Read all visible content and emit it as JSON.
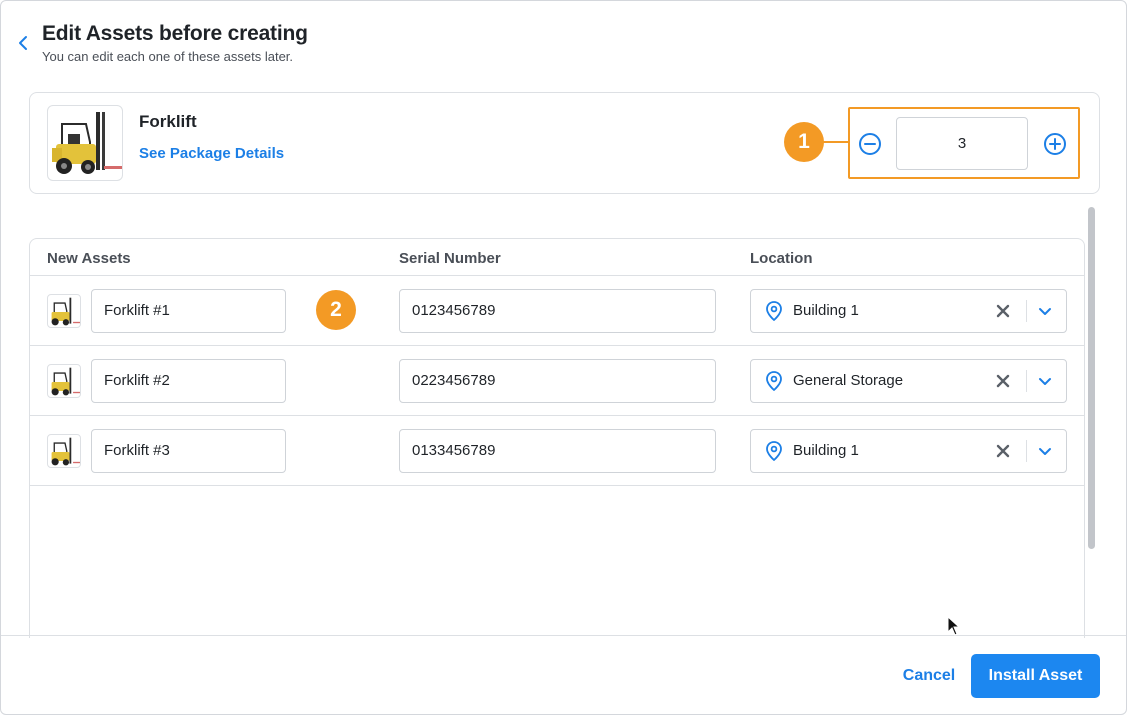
{
  "header": {
    "title": "Edit Assets before creating",
    "subtitle": "You can edit each one of these assets later."
  },
  "product": {
    "name": "Forklift",
    "link_label": "See Package Details",
    "quantity": "3"
  },
  "callouts": [
    "1",
    "2"
  ],
  "table": {
    "columns": [
      "New Assets",
      "Serial Number",
      "Location"
    ],
    "rows": [
      {
        "name": "Forklift #1",
        "serial": "0123456789",
        "location": "Building 1"
      },
      {
        "name": "Forklift #2",
        "serial": "0223456789",
        "location": "General Storage"
      },
      {
        "name": "Forklift #3",
        "serial": "0133456789",
        "location": "Building 1"
      }
    ]
  },
  "footer": {
    "cancel_label": "Cancel",
    "install_label": "Install Asset"
  },
  "colors": {
    "accent": "#1c87f0",
    "link": "#1c7fe6",
    "callout": "#f39a25"
  },
  "icons": {
    "back": "chevron-left-icon",
    "minus": "minus-circle-icon",
    "plus": "plus-circle-icon",
    "location": "map-pin-icon",
    "clear": "close-icon",
    "dropdown": "chevron-down-icon"
  }
}
